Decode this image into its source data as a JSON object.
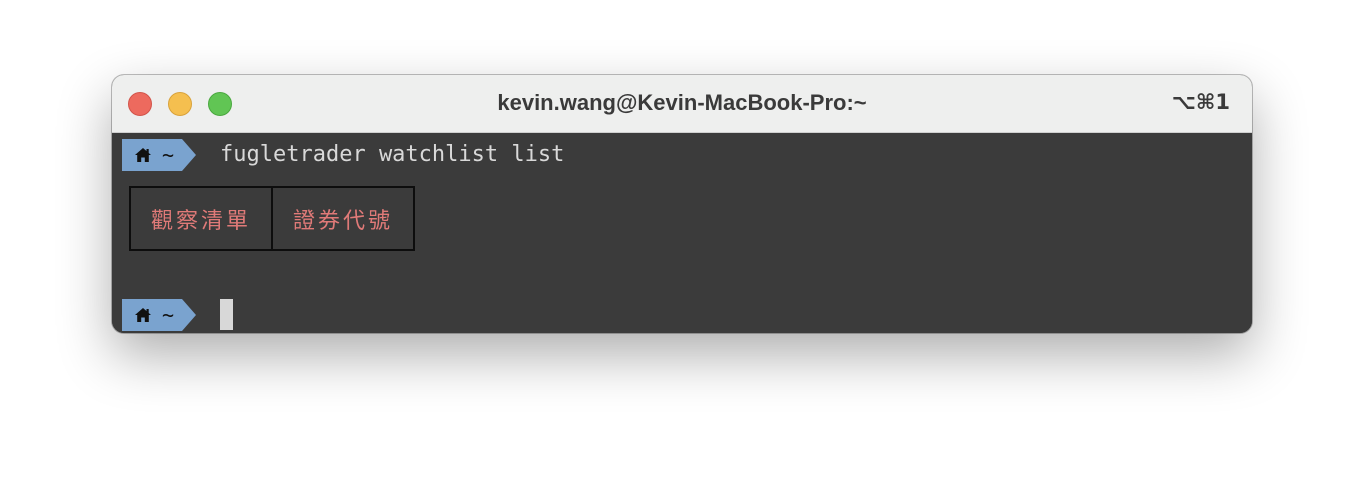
{
  "window": {
    "title": "kevin.wang@Kevin-MacBook-Pro:~",
    "shortcut": "⌥⌘1"
  },
  "prompt": {
    "path": "~",
    "icon": "home-icon"
  },
  "terminal": {
    "command": "fugletrader watchlist list",
    "table": {
      "headers": [
        "觀察清單",
        "證券代號"
      ]
    }
  },
  "colors": {
    "terminal_bg": "#3b3b3b",
    "prompt_bg": "#7aa3cf",
    "header_text": "#e07a78",
    "command_text": "#d9d9d9"
  }
}
